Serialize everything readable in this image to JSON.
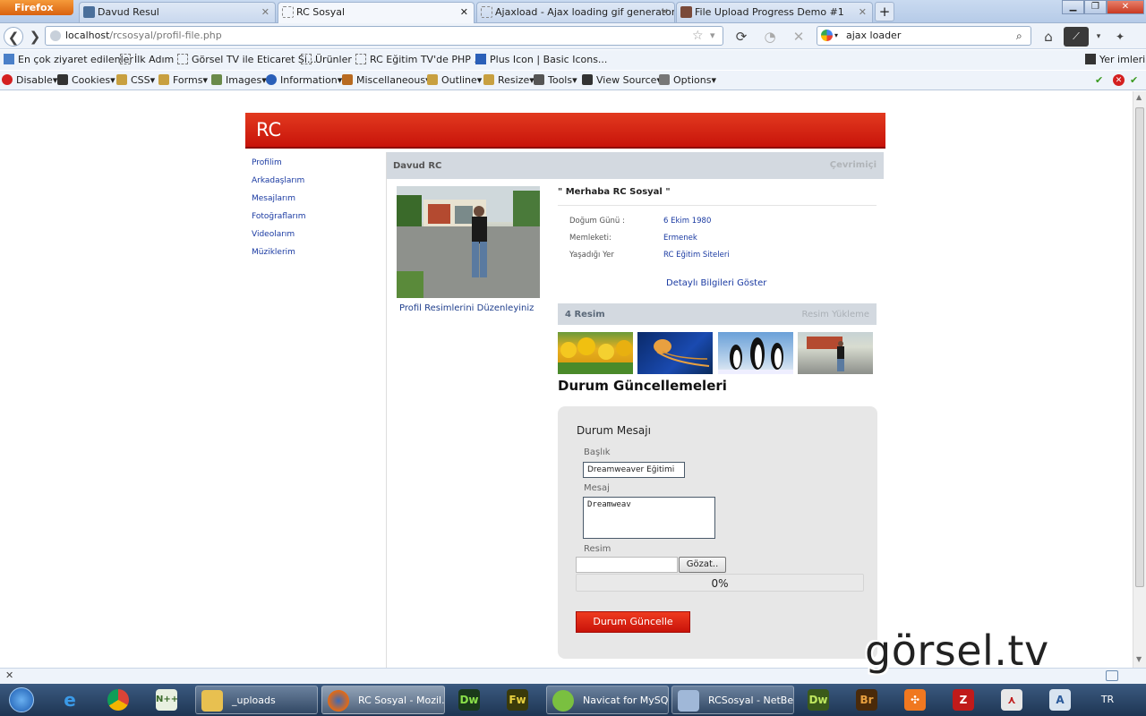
{
  "browser": {
    "menu_button": "Firefox",
    "tabs": [
      {
        "label": "Davud Resul",
        "active": false
      },
      {
        "label": "RC Sosyal",
        "active": true
      },
      {
        "label": "Ajaxload - Ajax loading gif generator",
        "active": false
      },
      {
        "label": "File Upload Progress Demo #1",
        "active": false
      }
    ],
    "new_tab": "+",
    "url_host": "localhost",
    "url_path": "/rcsosyal/profil-file.php",
    "search_value": "ajax loader",
    "bookmarks": [
      "En çok ziyaret edilenler",
      "İlk Adım",
      "Görsel TV ile Eticaret Si...",
      "Ürünler",
      "RC Eğitim TV'de PHP ...",
      "Plus Icon | Basic Icons..."
    ],
    "bookmarks_right": "Yer imleri",
    "dev_toolbar": [
      "Disable",
      "Cookies",
      "CSS",
      "Forms",
      "Images",
      "Information",
      "Miscellaneous",
      "Outline",
      "Resize",
      "Tools",
      "View Source",
      "Options"
    ]
  },
  "page": {
    "logo": "RC",
    "nav": [
      "Profilim",
      "Arkadaşlarım",
      "Mesajlarım",
      "Fotoğraflarım",
      "Videolarım",
      "Müziklerim"
    ],
    "profile_name": "Davud RC",
    "online_status": "Çevrimiçi",
    "edit_photos": "Profil Resimlerini Düzenleyiniz",
    "greeting": "\" Merhaba RC Sosyal \"",
    "info": [
      {
        "key": "Doğum Günü :",
        "value": "6 Ekim 1980"
      },
      {
        "key": "Memleketi:",
        "value": "Ermenek"
      },
      {
        "key": "Yaşadığı Yer",
        "value": "RC Eğitim Siteleri"
      }
    ],
    "detail_link": "Detaylı Bilgileri Göster",
    "pictures_count": "4 Resim",
    "pictures_upload": "Resim Yükleme",
    "status_title": "Durum Güncellemeleri",
    "form": {
      "title": "Durum Mesajı",
      "label_title": "Başlık",
      "title_value": "Dreamweaver Eğitimi",
      "label_message": "Mesaj",
      "message_value": "Dreamweav",
      "label_image": "Resim",
      "browse": "Gözat..",
      "progress_text": "0%",
      "progress_value": 0,
      "submit": "Durum Güncelle"
    }
  },
  "taskbar": {
    "items": [
      "_uploads",
      "RC Sosyal - Mozil...",
      "Navicat for MySQL",
      "RCSosyal - NetBe..."
    ],
    "language": "TR"
  },
  "watermark": "görsel.tv",
  "colors": {
    "brand_red": "#d41e0e",
    "link_blue": "#1a3aa2"
  }
}
